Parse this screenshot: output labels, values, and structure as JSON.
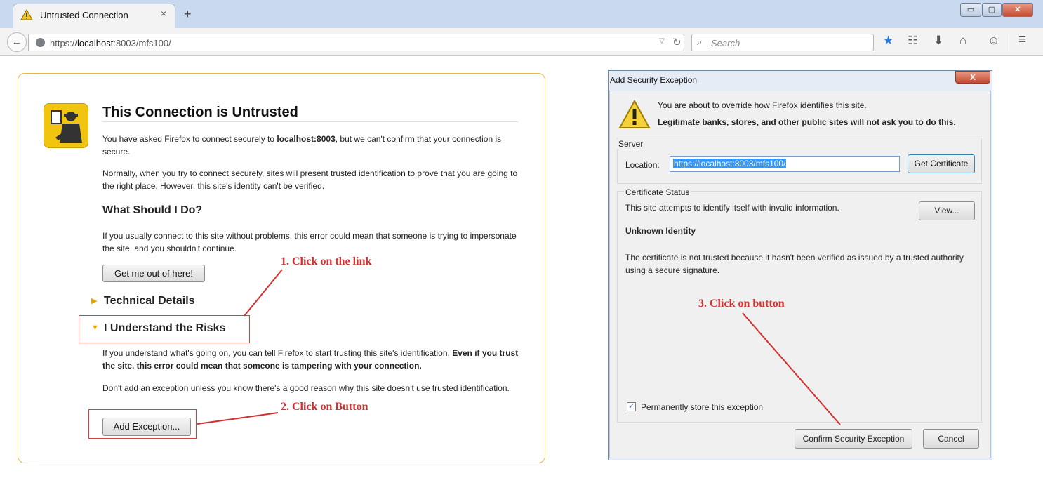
{
  "browser": {
    "tab_title": "Untrusted Connection",
    "tab_close": "×",
    "new_tab": "+",
    "url_prefix": "https://",
    "url_host": "localhost",
    "url_rest": ":8003/mfs100/",
    "search_placeholder": "Search",
    "window_buttons": {
      "minimize": "▭",
      "maximize": "▢",
      "close": "✕"
    },
    "icons": [
      "back-arrow-icon",
      "globe-icon",
      "reload-icon",
      "search-icon",
      "star-icon",
      "reading-list-icon",
      "download-icon",
      "home-icon",
      "chat-icon",
      "menu-icon"
    ]
  },
  "error_page": {
    "title": "This Connection is Untrusted",
    "para1_before": "You have asked Firefox to connect securely to ",
    "para1_host": "localhost:8003",
    "para1_after": ", but we can't confirm that your connection is secure.",
    "para2": "Normally, when you try to connect securely, sites will present trusted identification to prove that you are going to the right place. However, this site's identity can't be verified.",
    "what_title": "What Should I Do?",
    "para3": "If you usually connect to this site without problems, this error could mean that someone is trying to impersonate the site, and you shouldn't continue.",
    "get_out_button": "Get me out of here!",
    "technical_details": "Technical Details",
    "understand_risks": "I Understand the Risks",
    "para4_plain": "If you understand what's going on, you can tell Firefox to start trusting this site's identification. ",
    "para4_bold": "Even if you trust the site, this error could mean that someone is tampering with your connection.",
    "para5": "Don't add an exception unless you know there's a good reason why this site doesn't use trusted identification.",
    "add_exception_button": "Add Exception..."
  },
  "dialog": {
    "title": "Add Security Exception",
    "close": "X",
    "line1": "You are about to override how Firefox identifies this site.",
    "line2": "Legitimate banks, stores, and other public sites will not ask you to do this.",
    "server_legend": "Server",
    "location_label": "Location:",
    "location_value": "https://localhost:8003/mfs100/",
    "get_certificate_button": "Get Certificate",
    "status_legend": "Certificate Status",
    "status_text": "This site attempts to identify itself with invalid information.",
    "view_button": "View...",
    "unknown_identity": "Unknown Identity",
    "cert_description": "The certificate is not trusted because it hasn't been verified as issued by a trusted authority using a secure signature.",
    "permanent_label": "Permanently store this exception",
    "permanent_checked": true,
    "confirm_button": "Confirm Security Exception",
    "cancel_button": "Cancel"
  },
  "annotations": {
    "step1": "1. Click on the link",
    "step2": "2. Click on Button",
    "step3": "3. Click on button",
    "color": "#d32f2f"
  }
}
